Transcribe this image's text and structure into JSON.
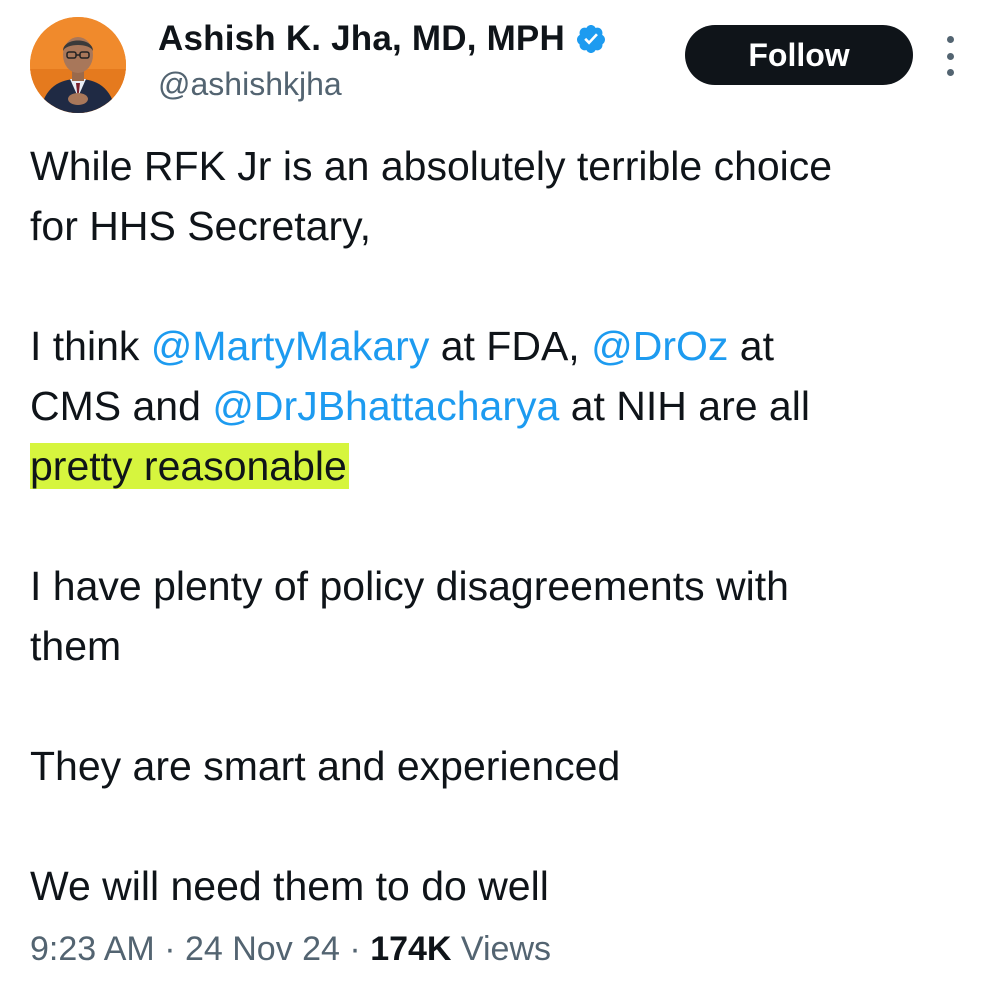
{
  "author": {
    "name": "Ashish K. Jha, MD, MPH",
    "handle": "@ashishkjha",
    "verified": true
  },
  "header": {
    "follow_label": "Follow"
  },
  "tweet": {
    "para1": {
      "line1": "While RFK Jr is an absolutely terrible choice",
      "line2": "for HHS Secretary,"
    },
    "para2": {
      "t1": "I think ",
      "m1": "@MartyMakary",
      "t2": " at FDA, ",
      "m2": "@DrOz",
      "t3": " at",
      "t4": "CMS and ",
      "m3": "@DrJBhattacharya",
      "t5": " at NIH are all",
      "highlight": "pretty reasonable"
    },
    "para3": {
      "line1": "I have plenty of policy disagreements with",
      "line2": "them"
    },
    "para4": "They are smart and experienced",
    "para5": "We will need them to do well"
  },
  "meta": {
    "time": "9:23 AM",
    "sep1": " · ",
    "date": "24 Nov 24",
    "sep2": " · ",
    "views_count": "174K",
    "views_label": " Views"
  },
  "colors": {
    "link": "#1d9bf0",
    "highlight": "#d6f53e",
    "verified": "#1d9bf0",
    "secondary_text": "#536471",
    "follow_bg": "#0f1419"
  }
}
